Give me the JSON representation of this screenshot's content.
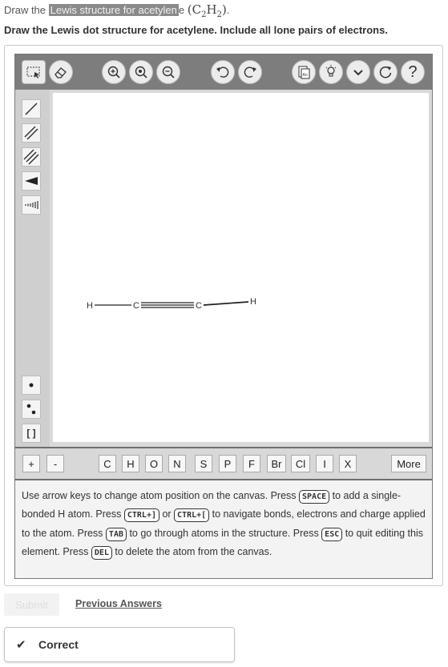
{
  "intro": {
    "prefix": "Draw the",
    "highlight": "Lewis structure for acetylen",
    "suffix": "e"
  },
  "prompt": "Draw the Lewis dot structure for acetylene. Include all lone pairs of electrons.",
  "toolbar": {
    "buttons": [
      "select-icon",
      "eraser-icon",
      "zoom-in-icon",
      "zoom-fit-icon",
      "zoom-out-icon",
      "undo-icon",
      "redo-icon",
      "templates-icon",
      "hint-icon",
      "dropdown-icon",
      "reset-icon",
      "help-icon"
    ],
    "help_label": "?"
  },
  "sidebar": {
    "tools": [
      "single-bond-icon",
      "double-bond-icon",
      "triple-bond-icon",
      "wedge-bond-icon",
      "hash-bond-icon",
      "lone-electron-icon",
      "lone-pair-icon",
      "bracket-icon"
    ],
    "bracket_label": "[ ]"
  },
  "molecule": {
    "atoms": [
      {
        "symbol": "H"
      },
      {
        "symbol": "C"
      },
      {
        "symbol": "C"
      },
      {
        "symbol": "H"
      }
    ],
    "bonds": [
      "single",
      "triple",
      "single"
    ]
  },
  "atom_bar": {
    "plus": "+",
    "minus": "-",
    "elements": [
      "C",
      "H",
      "O",
      "N",
      "S",
      "P",
      "F",
      "Br",
      "Cl",
      "I",
      "X"
    ],
    "more": "More"
  },
  "help": {
    "t1": "Use arrow keys to change atom position on the canvas. Press ",
    "k_space": "SPACE",
    "t2": " to add a single-bonded H atom. Press ",
    "k_ctrl1": "CTRL+]",
    "t3": " or ",
    "k_ctrl2": "CTRL+[",
    "t4": " to navigate bonds, electrons and charge applied to the atom. Press ",
    "k_tab": "TAB",
    "t5": " to go through atoms in the structure. Press ",
    "k_esc": "ESC",
    "t6": " to quit editing this element. Press ",
    "k_del": "DEL",
    "t7": " to delete the atom from the canvas."
  },
  "submit": "Submit",
  "previous_answers": "Previous Answers",
  "feedback": {
    "icon": "check-icon",
    "label": "Correct"
  }
}
